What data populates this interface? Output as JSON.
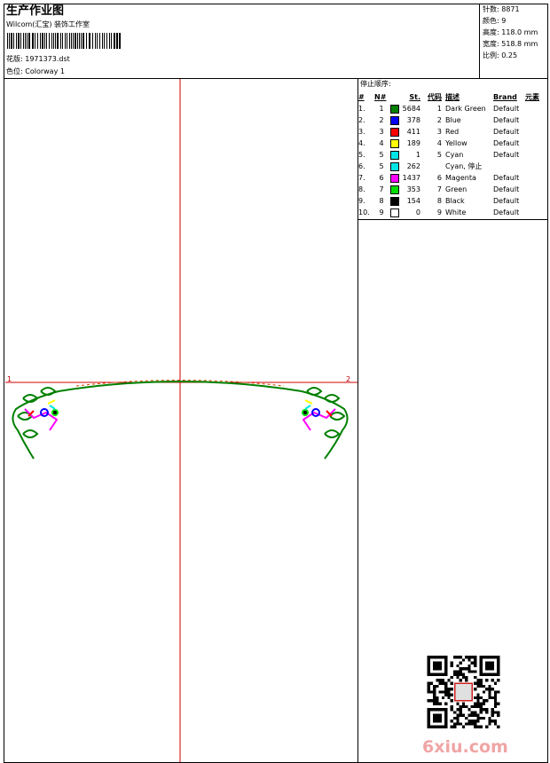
{
  "header": {
    "title": "生产作业图",
    "company": "Wilcom(汇宝) 装饰工作室",
    "design_label": "花版: 1971373.dst",
    "colorway_label": "色位: Colorway 1"
  },
  "stats": {
    "stitches": "针数: 8871",
    "colors": "颜色: 9",
    "height": "高度: 118.0 mm",
    "width": "宽度: 518.8 mm",
    "scale": "比例: 0.25"
  },
  "stop_sequence": {
    "title": "停止顺序:",
    "headers": [
      "#",
      "N#",
      "",
      "St.",
      "代码",
      "描述",
      "Brand",
      "元素"
    ],
    "rows": [
      {
        "idx": "1.",
        "n": "1",
        "color": "#008000",
        "st": "5684",
        "code": "1",
        "desc": "Dark Green",
        "brand": "Default"
      },
      {
        "idx": "2.",
        "n": "2",
        "color": "#0000ff",
        "st": "378",
        "code": "2",
        "desc": "Blue",
        "brand": "Default"
      },
      {
        "idx": "3.",
        "n": "3",
        "color": "#ff0000",
        "st": "411",
        "code": "3",
        "desc": "Red",
        "brand": "Default"
      },
      {
        "idx": "4.",
        "n": "4",
        "color": "#ffff00",
        "st": "189",
        "code": "4",
        "desc": "Yellow",
        "brand": "Default"
      },
      {
        "idx": "5.",
        "n": "5",
        "color": "#00e5e5",
        "st": "1",
        "code": "5",
        "desc": "Cyan",
        "brand": "Default"
      },
      {
        "idx": "6.",
        "n": "5",
        "color": "#00e5e5",
        "st": "262",
        "code": "",
        "desc": "Cyan, 停止",
        "brand": ""
      },
      {
        "idx": "7.",
        "n": "6",
        "color": "#ff00ff",
        "st": "1437",
        "code": "6",
        "desc": "Magenta",
        "brand": "Default"
      },
      {
        "idx": "8.",
        "n": "7",
        "color": "#00dd00",
        "st": "353",
        "code": "7",
        "desc": "Green",
        "brand": "Default"
      },
      {
        "idx": "9.",
        "n": "8",
        "color": "#000000",
        "st": "154",
        "code": "8",
        "desc": "Black",
        "brand": "Default"
      },
      {
        "idx": "10.",
        "n": "9",
        "color": "#ffffff",
        "st": "0",
        "code": "9",
        "desc": "White",
        "brand": "Default"
      }
    ]
  },
  "axis_labels": {
    "left": "1",
    "right": "2"
  },
  "watermark": "6xiu.com"
}
